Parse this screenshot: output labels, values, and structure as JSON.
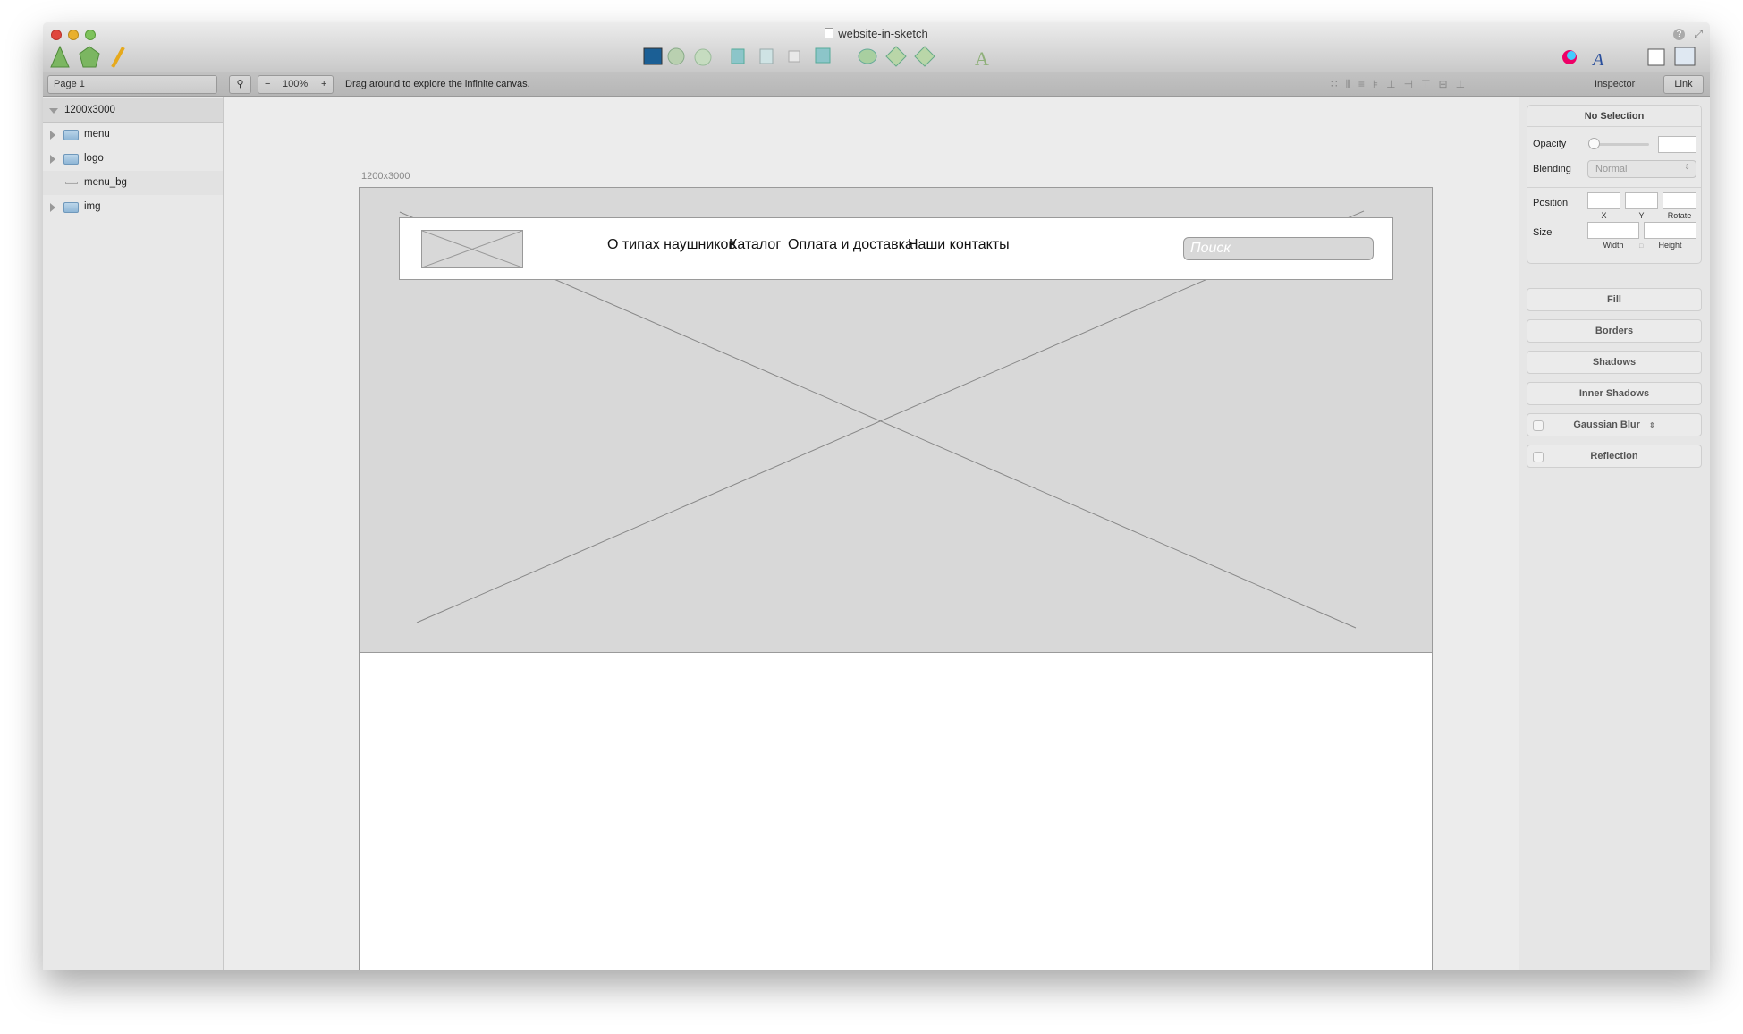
{
  "window": {
    "title": "website-in-sketch"
  },
  "toolbar": {
    "tools": [
      "triangle-tool-icon",
      "pentagon-tool-icon",
      "pencil-tool-icon"
    ],
    "image_tools": [
      "image-icon",
      "mask-icon",
      "group-circles-icon"
    ],
    "boolean_tools": [
      "union-icon",
      "subtract-icon",
      "intersect-icon",
      "difference-icon"
    ],
    "transform_tools": [
      "link-shapes-icon",
      "forward-icon",
      "backward-icon"
    ],
    "text_tool": "text-tool-icon",
    "right": [
      "color-wheel-icon",
      "font-icon",
      "grid-icon",
      "window-layout-icon"
    ]
  },
  "subbar": {
    "page": "Page 1",
    "zoom": "100%",
    "zoom_minus": "−",
    "zoom_plus": "+",
    "hint": "Drag around to explore the infinite canvas.",
    "inspector_label": "Inspector",
    "link_label": "Link"
  },
  "layers": {
    "root": "1200x3000",
    "items": [
      {
        "label": "menu",
        "type": "folder"
      },
      {
        "label": "logo",
        "type": "folder"
      },
      {
        "label": "menu_bg",
        "type": "shape"
      },
      {
        "label": "img",
        "type": "folder"
      }
    ]
  },
  "artboard": {
    "label": "1200x3000",
    "nav": [
      "О типах наушников",
      "Каталог",
      "Оплата и доставка",
      "Наши контакты"
    ],
    "search_placeholder": "Поиск"
  },
  "inspector": {
    "header": "No Selection",
    "opacity": "Opacity",
    "blending": "Blending",
    "blending_value": "Normal",
    "position": "Position",
    "x": "X",
    "y": "Y",
    "rotate": "Rotate",
    "size": "Size",
    "width": "Width",
    "height": "Height",
    "sections": [
      "Fill",
      "Borders",
      "Shadows",
      "Inner Shadows",
      "Gaussian Blur",
      "Reflection"
    ]
  },
  "colors": {
    "accent_green": "#7bb661",
    "hero": "#d8d8d8"
  }
}
